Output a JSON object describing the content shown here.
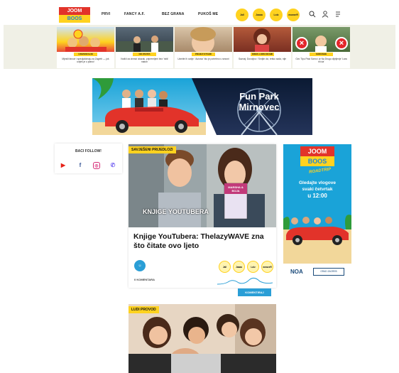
{
  "header": {
    "logo_text_top": "JOOM",
    "logo_text_bottom": "BOOS",
    "nav": [
      "PRVI",
      "FANCY A.F.",
      "BEZ GRANA",
      "PUKOŠ ME"
    ],
    "pills": [
      "Jall",
      "Jaaaa",
      "Lolz",
      "wowzeR"
    ],
    "icons": [
      "search-icon",
      "user-icon",
      "menu-icon"
    ],
    "accent": "#ffd21f"
  },
  "stories": [
    {
      "tag": "UNIVERZALNI",
      "caption": "Mjesili fanovi i specijaliziraju za Zagreb — još uvijek je u planu!"
    },
    {
      "tag": "OD ZIVOTA",
      "caption": "Vodiči za zimski izlazak, pripremljeni bez 'rizik' nakon"
    },
    {
      "tag": "PRIJEVI STVARI",
      "caption": "Uzmite ih ovdje: 'Autosio' što je potrebno u sezoni"
    },
    {
      "tag": "KREIS LORN DRAMI",
      "caption": "Saznaj: Dovoljno i 'Smijte da', teško sada, nije"
    },
    {
      "tag": "SORONIJE",
      "caption": "Ovo Tipu Past Samo i je Na Drugo dijeljenje 'Lara mi da'"
    }
  ],
  "banner": {
    "title_line1": "Fun Park",
    "title_line2": "Mirnovec"
  },
  "follow": {
    "title": "BACI FOLLOW!",
    "icons": [
      "youtube-icon",
      "facebook-icon",
      "instagram-icon",
      "viber-icon"
    ]
  },
  "article": {
    "category": "SAVJEŠENI PRIJEDLOZI",
    "overlay": "KNJIGE YOUTUBERA",
    "book": "MARSHA & BOJA",
    "title": "Knjige YouTubera: ThelazyWAVE zna što čitate ovo ljeto",
    "comments": "0 KOMENTARA",
    "reactions": [
      "Jall",
      "Jaaaa",
      "Lolz",
      "wowzeR"
    ],
    "comments_button": "KOMENTIRAJ"
  },
  "article2": {
    "category": "LUDI PROVOD"
  },
  "side_ad": {
    "logo_top": "JOOM",
    "logo_bottom": "BOOS",
    "sub": "ROADTRIP",
    "text_line1": "Gledajte vlogove",
    "text_line2": "svaki četvrtak",
    "text_line3": "u 12:00",
    "sponsor1": "NOA",
    "sponsor2": "GRAD ZAGREB"
  }
}
